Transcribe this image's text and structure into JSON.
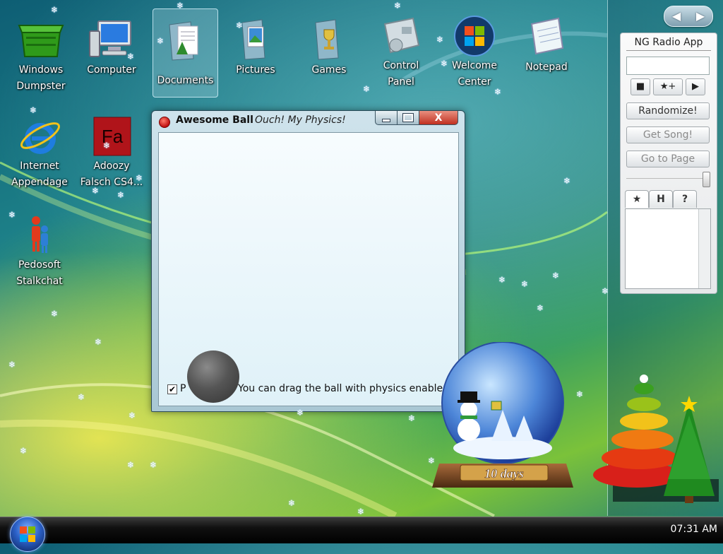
{
  "desktop": {
    "icons": [
      {
        "label": "Windows\nDumpster",
        "icon": "dumpster-icon"
      },
      {
        "label": "Computer",
        "icon": "computer-icon"
      },
      {
        "label": "Documents",
        "icon": "documents-folder-icon"
      },
      {
        "label": "Pictures",
        "icon": "pictures-folder-icon"
      },
      {
        "label": "Games",
        "icon": "games-folder-icon"
      },
      {
        "label": "Control\nPanel",
        "icon": "control-panel-icon"
      },
      {
        "label": "Welcome\nCenter",
        "icon": "windows-logo-icon"
      },
      {
        "label": "Notepad",
        "icon": "notepad-icon"
      },
      {
        "label": "Internet\nAppendage",
        "icon": "internet-explorer-icon"
      },
      {
        "label": "Adoozy\nFalsch CS4...",
        "icon": "adobe-flash-icon"
      },
      {
        "label": "Pedosoft\nStalkchat",
        "icon": "messenger-people-icon"
      }
    ]
  },
  "window": {
    "title": "Awesome Ball",
    "subtitle": "Ouch!  My Physics!",
    "checkbox_label": "P",
    "checkbox_checked": "✔",
    "hint": "You can drag the ball with physics enabled.",
    "close_glyph": "X"
  },
  "sidebar": {
    "nav_left": "◀",
    "nav_right": "▶"
  },
  "radio_gadget": {
    "title": "NG Radio App",
    "stop_glyph": "■",
    "favorite_glyph": "★+",
    "play_glyph": "▶",
    "randomize_label": "Randomize!",
    "get_song_label": "Get Song!",
    "go_to_page_label": "Go to Page",
    "tabs": [
      "★",
      "H",
      "?"
    ]
  },
  "snow_globe": {
    "countdown": "10 days"
  },
  "taskbar": {
    "clock": "07:31 AM"
  },
  "colors": {
    "desktop_teal": "#1d8088",
    "close_red": "#c03020",
    "taskbar_black": "#000000"
  }
}
